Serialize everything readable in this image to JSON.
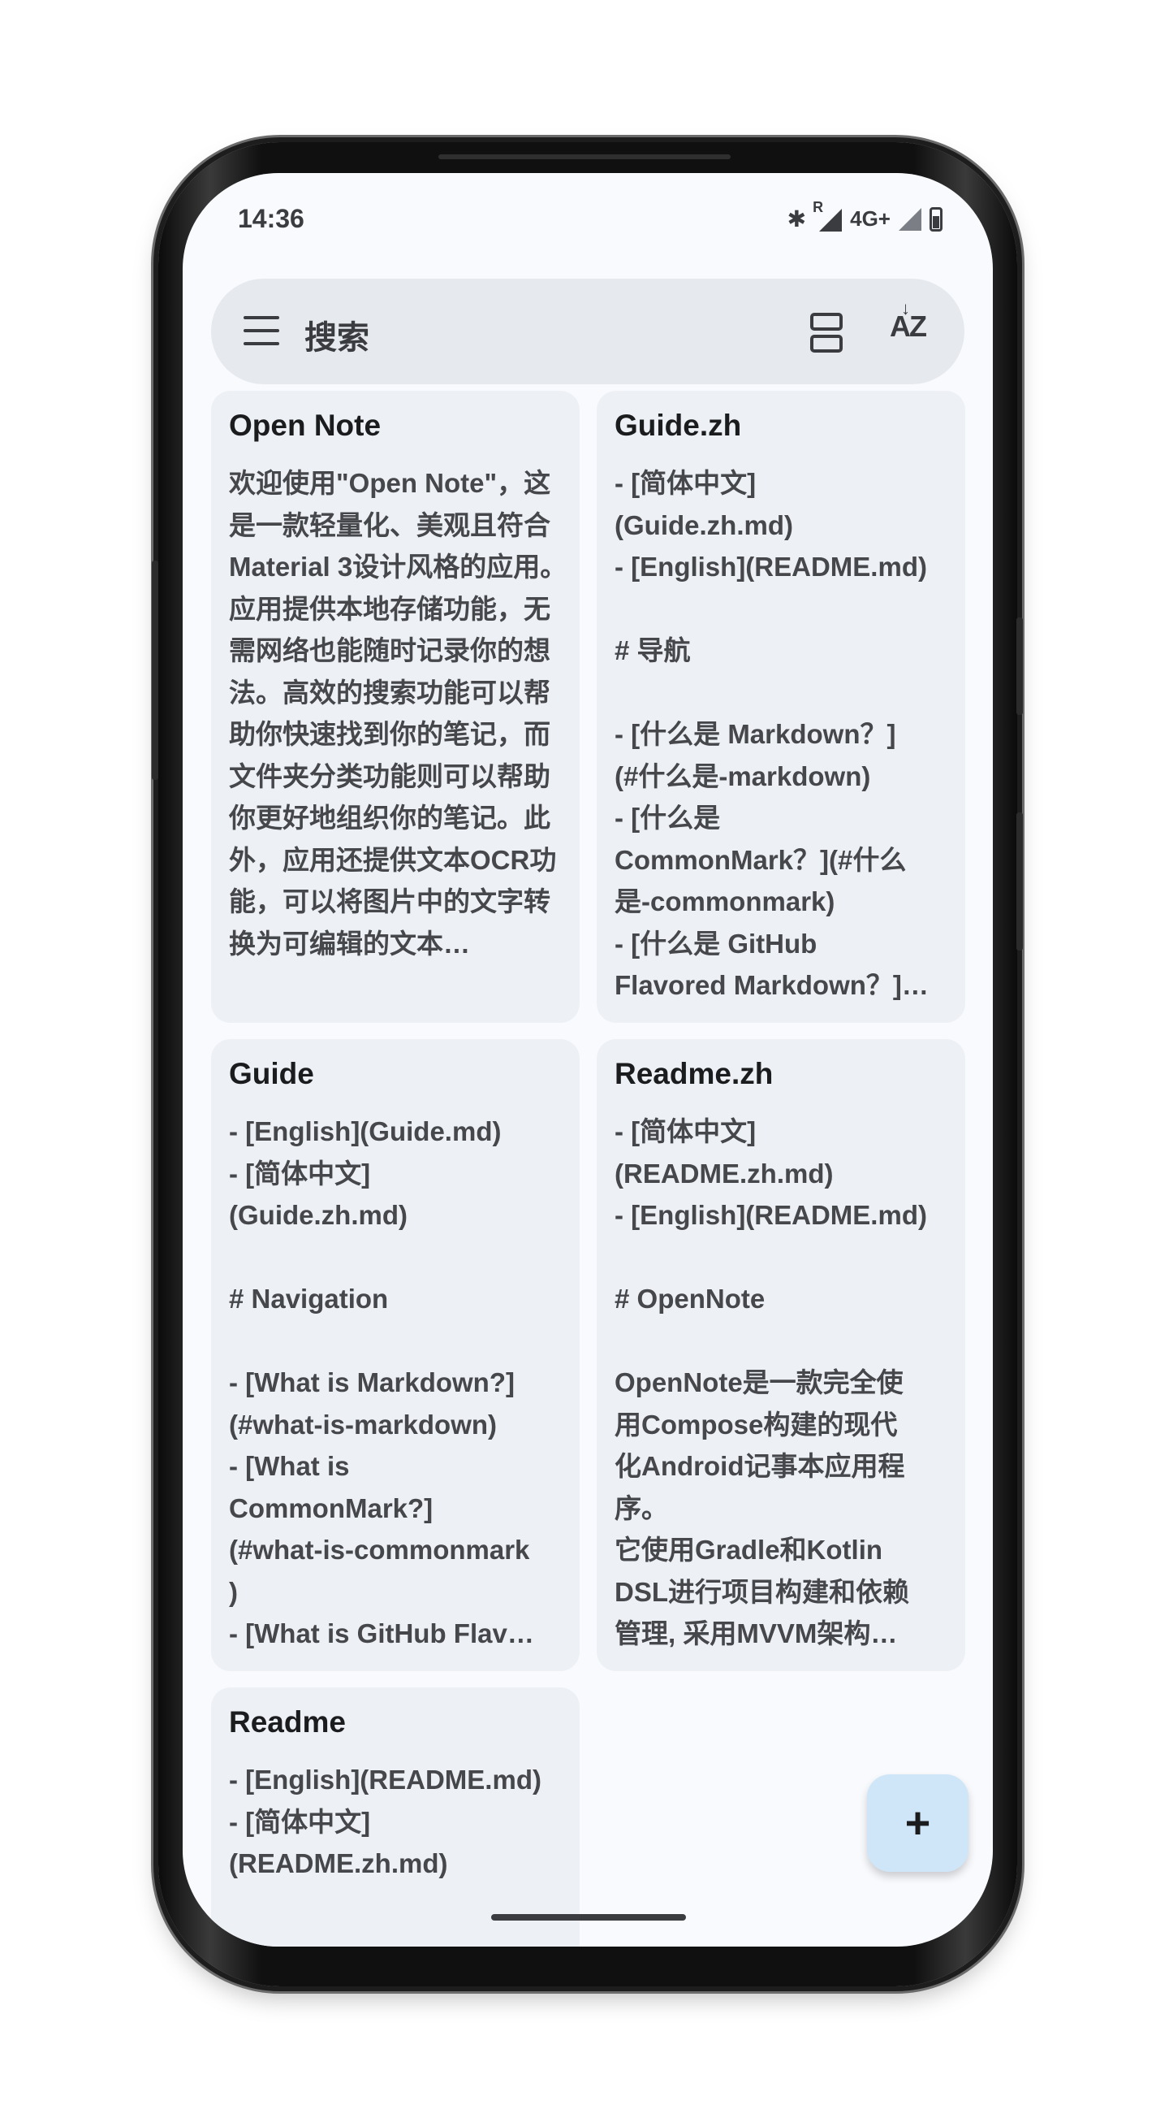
{
  "status_bar": {
    "time": "14:36",
    "bluetooth_icon": "bluetooth-icon",
    "roaming_label": "R",
    "network_label": "4G+"
  },
  "search": {
    "placeholder": "搜索",
    "menu_icon": "menu-icon",
    "layout_icon": "view-agenda-icon",
    "sort_icon": "sort-by-alpha-icon"
  },
  "notes": [
    {
      "title": "Open Note",
      "body": "欢迎使用\"Open Note\"，这是一款轻量化、美观且符合Material 3设计风格的应用。应用提供本地存储功能，无需网络也能随时记录你的想法。高效的搜索功能可以帮助你快速找到你的笔记，而文件夹分类功能则可以帮助你更好地组织你的笔记。此外，应用还提供文本OCR功能，可以将图片中的文字转换为可编辑的文本…"
    },
    {
      "title": "Guide.zh",
      "body": "- [简体中文]\n(Guide.zh.md)\n- [English](README.md)\n\n# 导航\n\n- [什么是 Markdown？]\n(#什么是-markdown)\n- [什么是\nCommonMark？](#什么\n是-commonmark)\n- [什么是 GitHub\nFlavored Markdown？]…"
    },
    {
      "title": "Guide",
      "body": "- [English](Guide.md)\n- [简体中文]\n(Guide.zh.md)\n\n# Navigation\n\n- [What is Markdown?]\n(#what-is-markdown)\n- [What is\nCommonMark?]\n(#what-is-commonmark\n)\n- [What is GitHub Flav…"
    },
    {
      "title": "Readme.zh",
      "body": "- [简体中文]\n(README.zh.md)\n- [English](README.md)\n\n# OpenNote\n\nOpenNote是一款完全使\n用Compose构建的现代\n化Android记事本应用程\n序。\n它使用Gradle和Kotlin\nDSL进行项目构建和依赖\n管理, 采用MVVM架构…"
    },
    {
      "title": "Readme",
      "body": "- [English](README.md)\n- [简体中文]\n(README.zh.md)"
    }
  ],
  "fab": {
    "label": "+",
    "icon": "add-icon"
  }
}
